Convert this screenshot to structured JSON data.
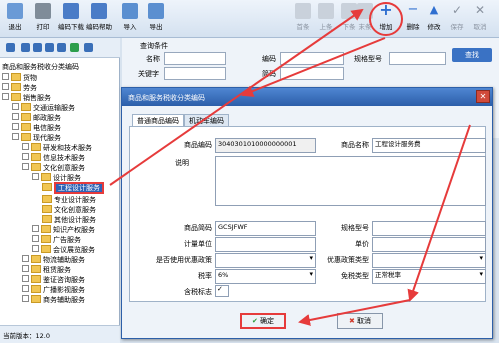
{
  "toolbar": {
    "left_buttons": [
      {
        "label": "退出",
        "icon": "exit-icon"
      },
      {
        "label": "打印",
        "icon": "print-icon"
      },
      {
        "label": "编码下载",
        "icon": "download-icon"
      },
      {
        "label": "编码帮助",
        "icon": "help-icon"
      },
      {
        "label": "导入",
        "icon": "import-icon"
      },
      {
        "label": "导出",
        "icon": "export-icon"
      }
    ],
    "right_buttons": [
      {
        "label": "首条",
        "icon": "first-icon"
      },
      {
        "label": "上条",
        "icon": "prev-icon"
      },
      {
        "label": "下条",
        "icon": "next-icon"
      },
      {
        "label": "末条",
        "icon": "last-icon"
      },
      {
        "label": "增加",
        "icon": "add-icon"
      },
      {
        "label": "删除",
        "icon": "delete-icon"
      },
      {
        "label": "修改",
        "icon": "edit-icon"
      },
      {
        "label": "保存",
        "icon": "save-icon"
      },
      {
        "label": "取消",
        "icon": "cancel-icon"
      }
    ]
  },
  "tree": {
    "items": [
      "商品和服务税收分类编码",
      "货物",
      "劳务",
      "销售服务",
      "交通运输服务",
      "邮政服务",
      "电信服务",
      "现代服务",
      "研发和技术服务",
      "信息技术服务",
      "文化创意服务",
      "设计服务",
      "工程设计服务",
      "专业设计服务",
      "文化创意服务",
      "其他设计服务",
      "知识产权服务",
      "广告服务",
      "会议展览服务",
      "物流辅助服务",
      "租赁服务",
      "鉴证咨询服务",
      "广播影视服务",
      "商务辅助服务"
    ],
    "status": "当前版本：12.0"
  },
  "query": {
    "title": "查询条件",
    "labels": {
      "name": "名称",
      "code": "编码",
      "spec": "规格型号",
      "keyword": "关键字",
      "shortcode": "简码"
    },
    "search_label": "查找"
  },
  "dialog": {
    "title": "商品和服务税收分类编码",
    "tabs": [
      "普通商品编码",
      "机动车编码"
    ],
    "labels": {
      "code": "商品编码",
      "name": "商品名称",
      "desc": "说明",
      "shortcode": "商品简码",
      "spec": "规格型号",
      "unit": "计量单位",
      "price": "单价",
      "preferential": "是否使用优惠政策",
      "preferential_type": "优惠政策类型",
      "tax_rate": "税率",
      "exempt_type": "免税类型",
      "tax_included": "含税标志"
    },
    "values": {
      "code": "3040301010000000001",
      "name": "工程设计服务费",
      "shortcode": "GCSJFWF",
      "tax_rate": "6%",
      "exempt_type": "正常税率"
    },
    "ok_label": "确定",
    "cancel_label": "取消"
  },
  "colors": {
    "highlight": "#e63b3b",
    "title_bar": "#2c5ea9"
  }
}
